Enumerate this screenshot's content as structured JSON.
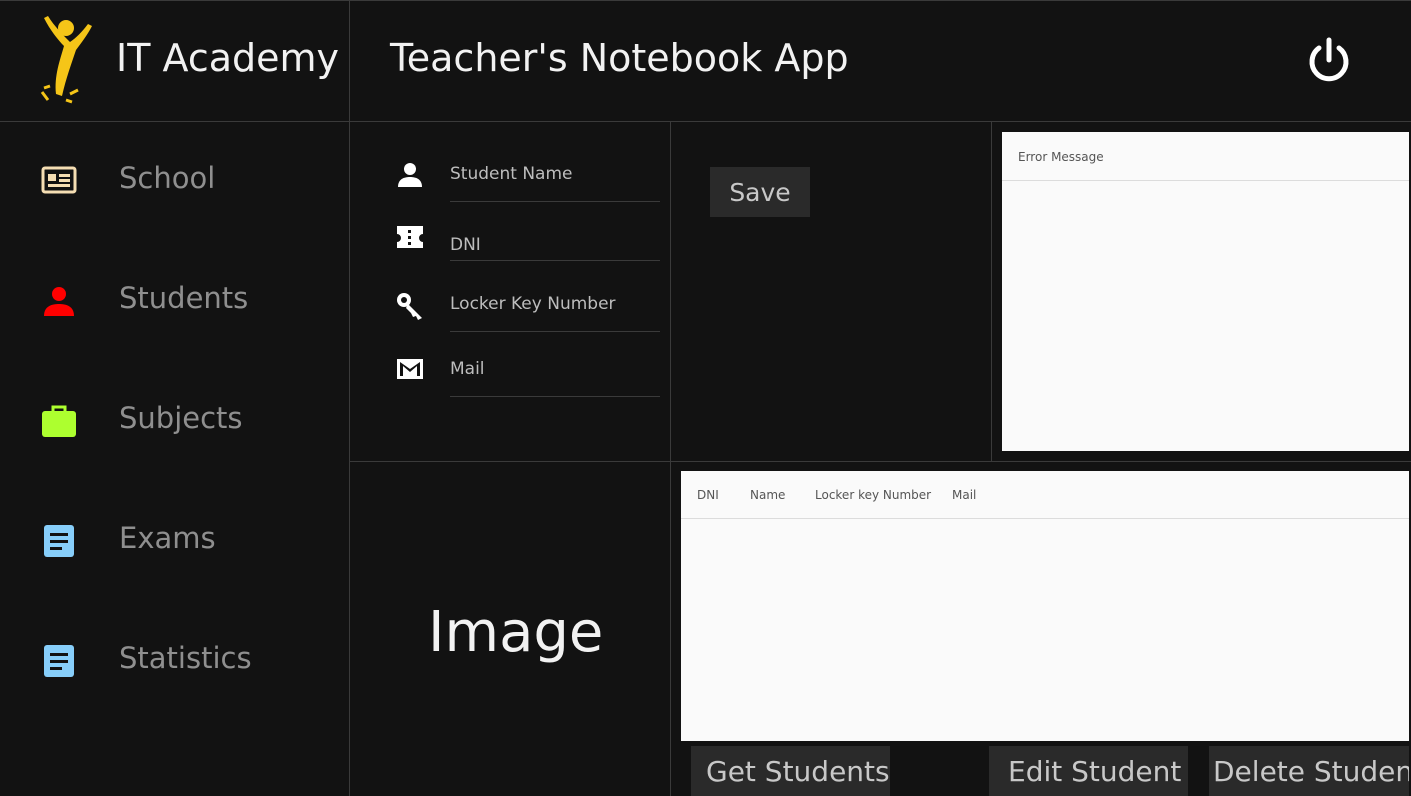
{
  "header": {
    "brand": "IT Academy",
    "app_title": "Teacher's Notebook App",
    "power_icon": "power-icon"
  },
  "sidebar": {
    "items": [
      {
        "label": "School",
        "icon": "id-card-icon",
        "color": "#f5deb3"
      },
      {
        "label": "Students",
        "icon": "person-icon",
        "color": "#ff0000"
      },
      {
        "label": "Subjects",
        "icon": "briefcase-icon",
        "color": "#adff2f"
      },
      {
        "label": "Exams",
        "icon": "document-icon",
        "color": "#87cefa"
      },
      {
        "label": "Statistics",
        "icon": "document-icon",
        "color": "#87cefa"
      }
    ]
  },
  "form": {
    "fields": [
      {
        "label": "Student Name",
        "icon": "person-icon"
      },
      {
        "label": "DNI",
        "icon": "ticket-icon"
      },
      {
        "label": "Locker Key Number",
        "icon": "key-icon"
      },
      {
        "label": "Mail",
        "icon": "mail-icon"
      }
    ],
    "save_label": "Save"
  },
  "error_panel": {
    "header": "Error Message"
  },
  "image_placeholder": "Image",
  "table": {
    "columns": [
      "DNI",
      "Name",
      "Locker key Number",
      "Mail"
    ],
    "rows": []
  },
  "actions": {
    "get_students": "Get Students",
    "edit_student": "Edit Student",
    "delete_student": "Delete Student"
  },
  "colors": {
    "background": "#121212",
    "logo_yellow": "#f5c518",
    "panel": "#fafafa",
    "button": "#2a2a2a"
  }
}
